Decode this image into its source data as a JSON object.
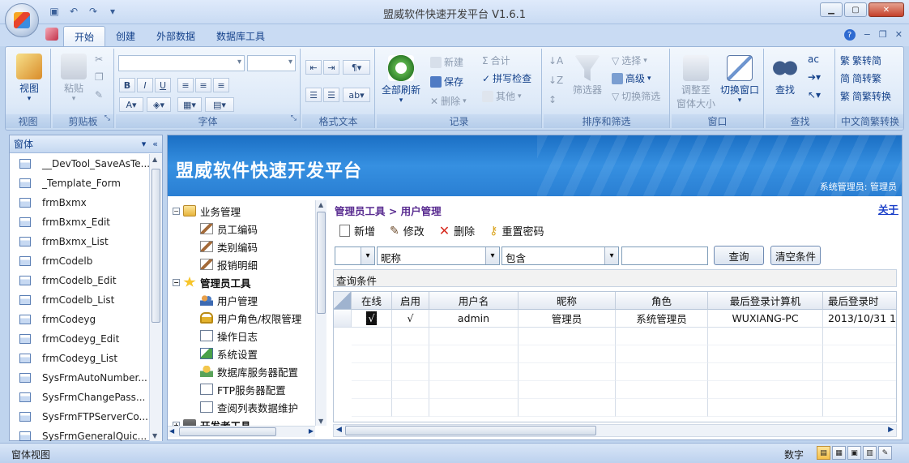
{
  "window": {
    "title": "盟威软件快速开发平台 V1.6.1"
  },
  "ribbon_tabs": [
    "开始",
    "创建",
    "外部数据",
    "数据库工具"
  ],
  "ribbon": {
    "view": {
      "label": "视图",
      "group": "视图"
    },
    "clipboard": {
      "paste": "粘贴",
      "group": "剪贴板"
    },
    "font": {
      "group": "字体"
    },
    "richtext": {
      "group": "格式文本"
    },
    "records": {
      "refresh": "全部刷新",
      "new": "新建",
      "save": "保存",
      "delete": "删除",
      "totals": "合计",
      "spelling": "拼写检查",
      "more": "其他",
      "group": "记录"
    },
    "sort": {
      "filter": "筛选器",
      "selection": "选择",
      "advanced": "高级",
      "toggle": "切换筛选",
      "group": "排序和筛选"
    },
    "window": {
      "fit_line1": "调整至",
      "fit_line2": "窗体大小",
      "switch": "切换窗口",
      "group": "窗口"
    },
    "find": {
      "find": "查找",
      "group": "查找"
    },
    "chinese": {
      "t2s": "繁转简",
      "s2t": "简转繁",
      "convert": "简繁转换",
      "group": "中文简繁转换"
    }
  },
  "nav": {
    "header": "窗体",
    "items": [
      "__DevTool_SaveAsTe...",
      "_Template_Form",
      "frmBxmx",
      "frmBxmx_Edit",
      "frmBxmx_List",
      "frmCodelb",
      "frmCodelb_Edit",
      "frmCodelb_List",
      "frmCodeyg",
      "frmCodeyg_Edit",
      "frmCodeyg_List",
      "SysFrmAutoNumber...",
      "SysFrmChangePass...",
      "SysFrmFTPServerCo...",
      "SysFrmGeneralQuic..."
    ]
  },
  "banner": {
    "title": "盟威软件快速开发平台",
    "user": "系统管理员: 管理员"
  },
  "tree": [
    {
      "label": "业务管理",
      "level": 0,
      "expander": "−",
      "bold": false,
      "icon": "folder-icon"
    },
    {
      "label": "员工编码",
      "level": 1,
      "bold": false,
      "icon": "edit-icon"
    },
    {
      "label": "类别编码",
      "level": 1,
      "bold": false,
      "icon": "edit-icon"
    },
    {
      "label": "报销明细",
      "level": 1,
      "bold": false,
      "icon": "edit-icon"
    },
    {
      "label": "管理员工具",
      "level": 0,
      "expander": "−",
      "bold": true,
      "icon": "star-icon"
    },
    {
      "label": "用户管理",
      "level": 1,
      "bold": false,
      "icon": "users-icon"
    },
    {
      "label": "用户角色/权限管理",
      "level": 1,
      "bold": false,
      "icon": "lock-icon"
    },
    {
      "label": "操作日志",
      "level": 1,
      "bold": false,
      "icon": "document-icon"
    },
    {
      "label": "系统设置",
      "level": 1,
      "bold": false,
      "icon": "settings-icon"
    },
    {
      "label": "数据库服务器配置",
      "level": 1,
      "bold": false,
      "icon": "database-icon"
    },
    {
      "label": "FTP服务器配置",
      "level": 1,
      "bold": false,
      "icon": "document-icon"
    },
    {
      "label": "查阅列表数据维护",
      "level": 1,
      "bold": false,
      "icon": "document-icon"
    },
    {
      "label": "开发者工具",
      "level": 0,
      "expander": "+",
      "bold": true,
      "icon": "tools-icon"
    }
  ],
  "content": {
    "breadcrumb": "管理员工具 > 用户管理",
    "about": "关于",
    "toolbar": {
      "add": "新增",
      "edit": "修改",
      "delete": "删除",
      "reset_password": "重置密码"
    },
    "filter": {
      "field": "昵称",
      "operator": "包含",
      "value": "",
      "query": "查询",
      "clear": "清空条件"
    },
    "condition_label": "查询条件",
    "grid": {
      "columns": [
        "在线",
        "启用",
        "用户名",
        "昵称",
        "角色",
        "最后登录计算机",
        "最后登录时"
      ],
      "rows": [
        [
          "√",
          "√",
          "admin",
          "管理员",
          "系统管理员",
          "WUXIANG-PC",
          "2013/10/31 1"
        ]
      ]
    }
  },
  "status": {
    "left": "窗体视图",
    "right": "数字"
  }
}
